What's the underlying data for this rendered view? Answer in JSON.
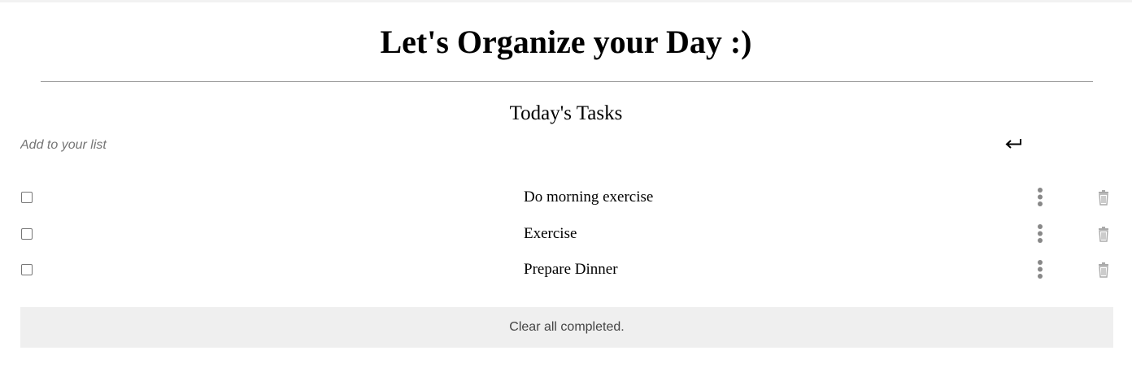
{
  "page": {
    "title": "Let's Organize your Day :)"
  },
  "list": {
    "heading": "Today's Tasks",
    "input_placeholder": "Add to your list",
    "input_value": "",
    "submit_icon": "enter-return-icon"
  },
  "tasks": [
    {
      "text": "Do morning exercise",
      "completed": false
    },
    {
      "text": "Exercise",
      "completed": false
    },
    {
      "text": "Prepare Dinner",
      "completed": false
    }
  ],
  "task_actions": {
    "menu_icon": "vertical-dots-icon",
    "delete_icon": "trash-icon"
  },
  "footer": {
    "clear_label": "Clear all completed."
  },
  "colors": {
    "icon_gray": "#888888",
    "trash_gray": "#aaaaaa",
    "clear_bg": "#efefef",
    "divider": "#999999"
  }
}
